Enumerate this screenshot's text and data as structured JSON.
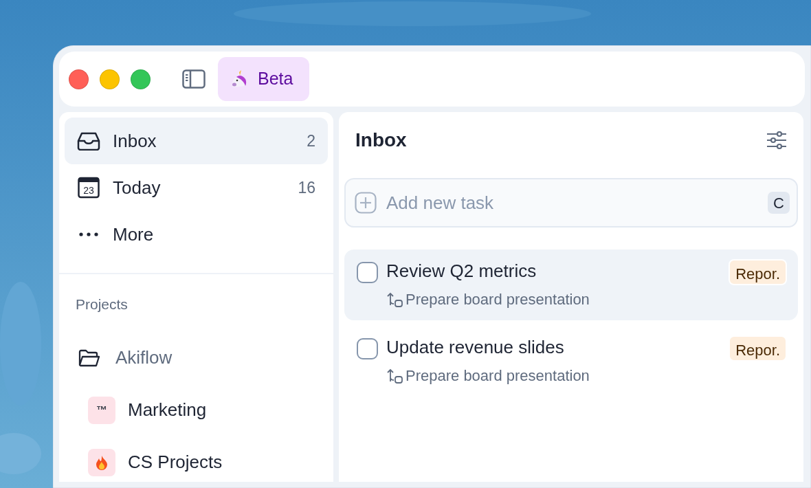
{
  "window": {
    "controls": [
      {
        "color": "#ff5f57"
      },
      {
        "color": "#fcc400"
      },
      {
        "color": "#33c658"
      }
    ],
    "beta": {
      "label": "Beta"
    }
  },
  "nav": [
    {
      "kind": "inbox",
      "label": "Inbox",
      "count": "2",
      "selected": true
    },
    {
      "kind": "calendar",
      "label": "Today",
      "date": "23",
      "count": "16",
      "selected": false
    },
    {
      "kind": "more",
      "label": "More",
      "selected": false
    }
  ],
  "projects": {
    "heading": "Projects",
    "folders": [
      {
        "label": "Akiflow",
        "children": [
          {
            "kind": "text",
            "badge": "™",
            "label": "Marketing"
          },
          {
            "kind": "flame",
            "label": "CS Projects"
          }
        ]
      }
    ]
  },
  "main": {
    "title": "Inbox",
    "add_task": {
      "placeholder": "Add new task",
      "shortcut": "C"
    },
    "tasks": [
      {
        "title": "Review Q2 metrics",
        "parent": "Prepare board presentation",
        "tag": "Repor.",
        "checked": false,
        "selected": true
      },
      {
        "title": "Update revenue slides",
        "parent": "Prepare board presentation",
        "tag": "Repor.",
        "checked": false,
        "selected": false
      }
    ]
  }
}
